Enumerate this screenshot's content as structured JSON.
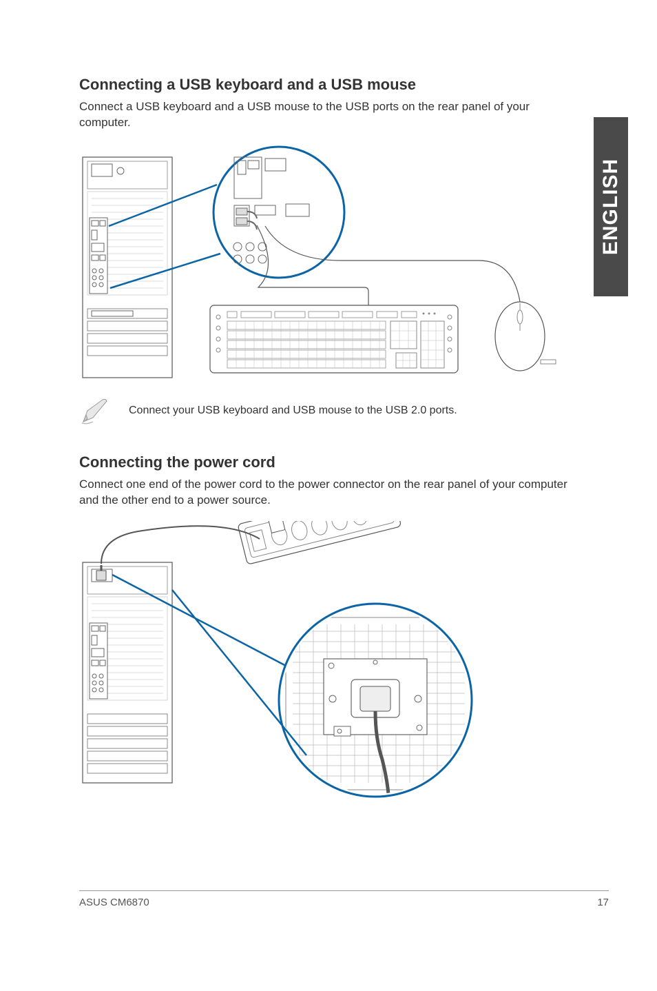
{
  "sideTab": "ENGLISH",
  "section1": {
    "heading": "Connecting a USB keyboard and a USB mouse",
    "body": "Connect a USB keyboard and a USB mouse to the USB ports on the rear panel of your computer."
  },
  "note1": {
    "text": "Connect your USB keyboard and USB mouse to the USB 2.0 ports."
  },
  "section2": {
    "heading": "Connecting the power cord",
    "body": "Connect one end of the power cord to the power connector on the rear panel of your computer and the other end to a power source."
  },
  "footer": {
    "left": "ASUS CM6870",
    "right": "17"
  }
}
